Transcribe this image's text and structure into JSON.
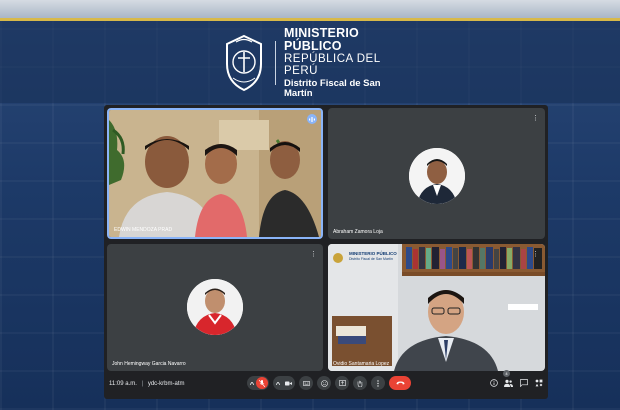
{
  "header": {
    "org_title": "MINISTERIO PÚBLICO",
    "org_subtitle": "REPÚBLICA DEL PERÚ",
    "district": "Distrito Fiscal de San Martín"
  },
  "meeting": {
    "time": "11:09 a.m.",
    "separator": "|",
    "code": "ydc-krbm-atm",
    "participants_count": "4",
    "tiles": [
      {
        "name": "EDWIN MENDOZA PRAD",
        "speaking": true
      },
      {
        "name": "Abraham Zamora Loja"
      },
      {
        "name": "John Hemingway Garcia Navarro"
      },
      {
        "name": "Ovidio Santamaria Lopez",
        "background_logo_title": "MINISTERIO PÚBLICO",
        "background_logo_sub": "Distrito Fiscal de San Martín"
      }
    ]
  },
  "colors": {
    "accent_blue": "#8ab4f8",
    "hangup_red": "#ea4335",
    "meet_bg": "#202124",
    "tile_bg": "#3c4043",
    "gold": "#d8b94a"
  },
  "icons": {
    "controls": [
      "chevron-up-icon",
      "microphone-off-icon",
      "chevron-up-icon",
      "camera-icon",
      "captions-icon",
      "emoji-icon",
      "present-icon",
      "raise-hand-icon",
      "more-options-icon",
      "hang-up-icon"
    ],
    "right": [
      "info-icon",
      "people-icon",
      "chat-icon",
      "activities-icon"
    ]
  }
}
